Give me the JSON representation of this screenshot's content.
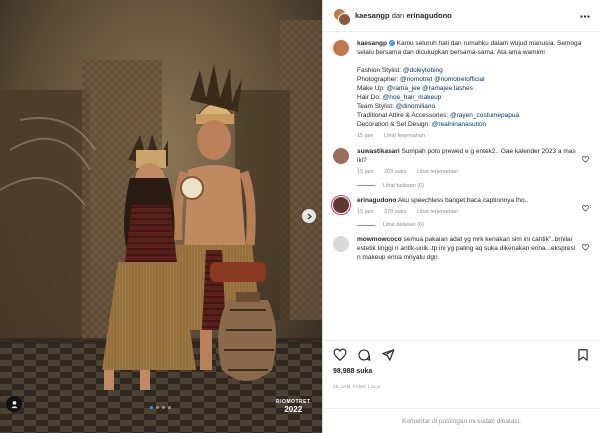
{
  "header": {
    "user1": "kaesangp",
    "connector": "dan",
    "user2": "erinagudono"
  },
  "caption": {
    "username": "kaesangp",
    "verified_mark": "✓",
    "text": "Kamu seluruh hati dan rumahku dalam wujud manusia. Semoga selalu bersama dan dicukupkan bersama-sama. Ata ama wamimi",
    "credits": [
      {
        "label": "Fashion Stylist:",
        "handles": "@doleytobing"
      },
      {
        "label": "Photographer:",
        "handles": "@riomotret @riomotretofficial"
      },
      {
        "label": "Make Up:",
        "handles": "@rama_jee @ramajee.lashes"
      },
      {
        "label": "Hair Do:",
        "handles": "@noe_hair_makeup"
      },
      {
        "label": "Team Stylist:",
        "handles": "@dinomiliano"
      },
      {
        "label": "Traditional Attire & Accessories:",
        "handles": "@rayen_costumepapua"
      },
      {
        "label": "Decoration & Set Design:",
        "handles": "@realninanasution"
      }
    ],
    "time": "15 jam",
    "translate": "Lihat terjemahan"
  },
  "comments": [
    {
      "username": "suwastikasari",
      "text": "Sumpah poto prewed e g entek2.. Gae kalender 2023 a mas iki?",
      "time": "15 jam",
      "likes": "203 suka",
      "translate": "Lihat terjemahan",
      "replies": "Lihat balasan (6)"
    },
    {
      "username": "erinagudono",
      "text": "Aku speechless banget baca captionnya lho..",
      "time": "15 jam",
      "likes": "278 suka",
      "translate": "Lihat terjemahan",
      "replies": "Lihat balasan (6)"
    },
    {
      "username": "mowmowcoco",
      "text": "semua pakaian adat yg mrk kenakan slm ini cantik\"..brnilai estetik tinggi n antik-unik..tp ini yg paling aq suka dikenakan erina...ekspresi n makeup erina mnyatu dgn"
    }
  ],
  "likes_count": "98,988 suka",
  "date_label": "15 JAM YANG LALU",
  "comments_disabled": "Komentar di postingan ini sudah dibatasi.",
  "watermark": {
    "brand": "RIOMOTRET",
    "year": "2022"
  },
  "carousel": {
    "current": 1,
    "total": 4
  },
  "colors": {
    "link": "#00376b",
    "verified": "#3897f0",
    "muted": "#8e8e8e",
    "carousel_active": "#3a8eff"
  }
}
